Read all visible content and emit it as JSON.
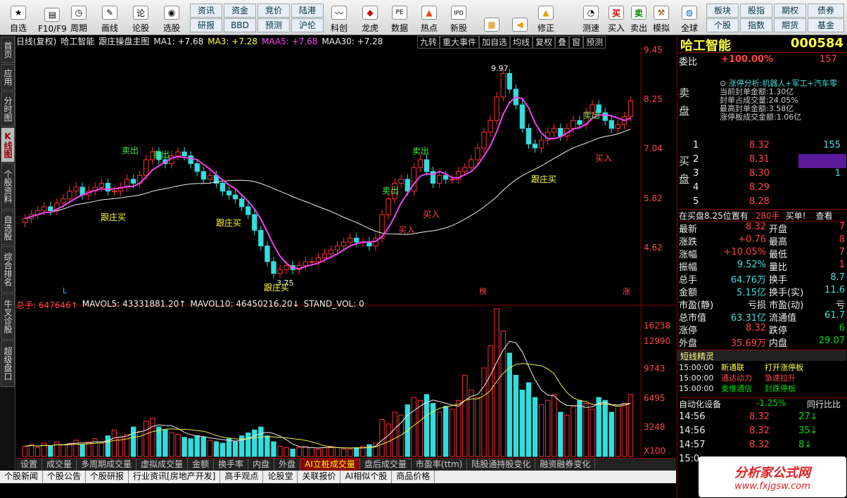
{
  "toolbar": {
    "items": [
      "自选",
      "F10/F9",
      "周期",
      "画线",
      "论股",
      "选股"
    ],
    "chips1": [
      "资讯",
      "资金",
      "竞价",
      "陆港"
    ],
    "chips2": [
      "研报",
      "BBD",
      "预测",
      "沪伦"
    ],
    "items2": [
      "科创",
      "龙虎",
      "数据",
      "热点",
      "新股"
    ],
    "items3": [
      "修正",
      "测速",
      "买入",
      "卖出",
      "模拟",
      "全球"
    ],
    "chips3": [
      "板块",
      "股指",
      "期权",
      "债券"
    ],
    "chips4": [
      "个股",
      "指数",
      "期货",
      "基金"
    ]
  },
  "leftnav": [
    "首页",
    "应用",
    "分时图",
    "K线图",
    "个股资料",
    "自选股",
    "综合排名",
    "牛叉诊股",
    "超级盘口"
  ],
  "header": {
    "period": "日线(复权)",
    "stock": "哈工智能",
    "formula": "跟庄操盘主图",
    "ma1": "MA1: +7.68",
    "ma3": "MA3: +7.28",
    "maa5": "MAA5: +7.68",
    "maa30": "MAA30: +7.28",
    "tools": [
      "九转",
      "重大事件",
      "加自选",
      "均线",
      "复权",
      "叠",
      "窗",
      "预测"
    ]
  },
  "price_axis": [
    "9.45",
    "8.25",
    "7.04",
    "5.82",
    "4.62"
  ],
  "labels": {
    "sell1": "卖出",
    "sell2": "卖出",
    "follow1": "跟庄买",
    "follow2": "跟庄买",
    "low": "3.75",
    "high": "9.97",
    "sell3": "卖出",
    "buy1": "买入",
    "sell4": "卖出",
    "buy2": "买入",
    "follow3": "跟庄买",
    "follow4": "跟庄买",
    "buy3": "买入",
    "sell5": "卖出",
    "L": "L",
    "bang": "榜",
    "zhang": "涨"
  },
  "volume": {
    "legend_total": "总手: 647646↑",
    "legend_mav5": "MAVOL5: 43331881.20↑",
    "legend_mav10": "MAVOL10: 46450216.20↓",
    "legend_std": "STAND_VOL: 0",
    "axis": [
      "16238",
      "12990",
      "9743",
      "6495",
      "3248",
      "X100"
    ]
  },
  "bottomtabs": [
    "设置",
    "成交量",
    "多周期成交量",
    "虚拟成交量",
    "金额",
    "换手率",
    "内盘",
    "外盘",
    "AI立桩成交量",
    "盘后成交量",
    "市盈率(ttm)",
    "陆股通持股变化",
    "融资融券变化"
  ],
  "infotabs": [
    "个股新闻",
    "个股公告",
    "个股研报",
    "行业资讯[房地产开发]",
    "高手观点",
    "论股堂",
    "关联报价",
    "AI相似个股",
    "商品价格"
  ],
  "side": {
    "name": "哈工智能",
    "code": "000584",
    "weibi_label": "委比",
    "weibi": "+100.00%",
    "weicha": "157",
    "analysis": "涨停分析:机器人+军工+汽车零",
    "seal1": "当前封单金额:1.30亿",
    "seal2": "封单占成交量:24.05%",
    "seal3": "最高封单金额:3.58亿",
    "seal4": "涨停板成交金额:1.06亿",
    "sell_label": "卖盘",
    "buy_label": "买盘",
    "buys": [
      {
        "n": "1",
        "p": "8.32",
        "v": "155"
      },
      {
        "n": "2",
        "p": "8.31",
        "v": ""
      },
      {
        "n": "3",
        "p": "8.30",
        "v": "1"
      },
      {
        "n": "4",
        "p": "8.29",
        "v": ""
      },
      {
        "n": "5",
        "p": "8.28",
        "v": ""
      }
    ],
    "buyline": "在买盘8.25位置有",
    "buyline_v": "280手",
    "buyline_t": "买单!",
    "look": "查看",
    "quote": [
      [
        "最新",
        "8.32",
        "开盘",
        "7"
      ],
      [
        "涨跌",
        "+0.76",
        "最高",
        "8"
      ],
      [
        "涨幅",
        "+10.05%",
        "最低",
        "7"
      ],
      [
        "振幅",
        "9.52%",
        "量比",
        "1"
      ],
      [
        "总手",
        "64.76万",
        "换手",
        "8.7"
      ],
      [
        "金额",
        "5.15亿",
        "换手(实)",
        "11.6"
      ],
      [
        "市盈(静)",
        "亏损",
        "市盈(动)",
        "亏"
      ],
      [
        "总市值",
        "63.31亿",
        "流通值",
        "61.7"
      ],
      [
        "涨停",
        "8.32",
        "跌停",
        "6"
      ],
      [
        "外盘",
        "35.69万",
        "内盘",
        "29.07"
      ]
    ],
    "sprite_title": "短线精灵",
    "sprites": [
      [
        "15:00:00",
        "新通联",
        "打开涨停板"
      ],
      [
        "15:00:00",
        "通达动力",
        "急速拉升"
      ],
      [
        "15:00:00",
        "奥维通信",
        "封跌停板"
      ]
    ],
    "sector": "自动化设备",
    "sector_chg": "-1.25%",
    "sector_btn": "同行比比",
    "ticks": [
      [
        "14:56",
        "8.32",
        "27"
      ],
      [
        "14:56",
        "8.32",
        "35"
      ],
      [
        "14:57",
        "8.32",
        "8"
      ],
      [
        "15:0",
        "",
        ""
      ]
    ],
    "logo": "分析家公式网",
    "logo_url": "www.fxjgsw.com"
  },
  "chart_data": {
    "type": "candlestick",
    "closes": [
      5.3,
      5.4,
      5.5,
      5.6,
      5.5,
      5.7,
      5.8,
      6.0,
      6.1,
      5.9,
      6.0,
      6.1,
      6.2,
      6.0,
      6.0,
      6.1,
      6.3,
      6.2,
      6.4,
      6.8,
      7.0,
      6.8,
      6.7,
      6.9,
      7.0,
      6.9,
      6.7,
      6.5,
      6.3,
      6.4,
      6.2,
      6.0,
      5.9,
      5.8,
      5.6,
      5.4,
      5.0,
      4.6,
      4.2,
      3.9,
      4.0,
      4.1,
      4.0,
      4.1,
      4.2,
      4.2,
      4.3,
      4.4,
      4.5,
      4.6,
      4.7,
      4.8,
      4.7,
      4.7,
      4.6,
      4.8,
      5.4,
      5.8,
      6.2,
      6.3,
      6.0,
      6.6,
      6.8,
      6.5,
      6.2,
      6.4,
      6.3,
      6.3,
      6.5,
      6.6,
      6.8,
      7.1,
      7.5,
      7.8,
      8.4,
      9.0,
      8.6,
      8.2,
      7.6,
      7.2,
      7.1,
      7.3,
      7.5,
      7.6,
      7.4,
      7.6,
      7.8,
      7.7,
      8.0,
      8.2,
      8.0,
      7.8,
      7.6,
      7.7,
      7.9,
      8.3
    ],
    "volumes": [
      7,
      8,
      6,
      9,
      7,
      10,
      8,
      9,
      11,
      8,
      10,
      12,
      9,
      14,
      18,
      13,
      15,
      20,
      17,
      24,
      26,
      20,
      18,
      16,
      15,
      13,
      12,
      14,
      13,
      11,
      10,
      9,
      12,
      10,
      14,
      16,
      18,
      20,
      14,
      10,
      7,
      6,
      5,
      6,
      7,
      6,
      5,
      6,
      7,
      6,
      5,
      5,
      6,
      7,
      8,
      9,
      25,
      22,
      30,
      28,
      35,
      40,
      38,
      42,
      36,
      30,
      34,
      32,
      38,
      55,
      45,
      40,
      60,
      75,
      100,
      85,
      70,
      55,
      45,
      50,
      40,
      35,
      38,
      42,
      30,
      28,
      34,
      38,
      36,
      32,
      40,
      38,
      30,
      34,
      36,
      42
    ],
    "ylim": [
      3.5,
      9.6
    ]
  }
}
